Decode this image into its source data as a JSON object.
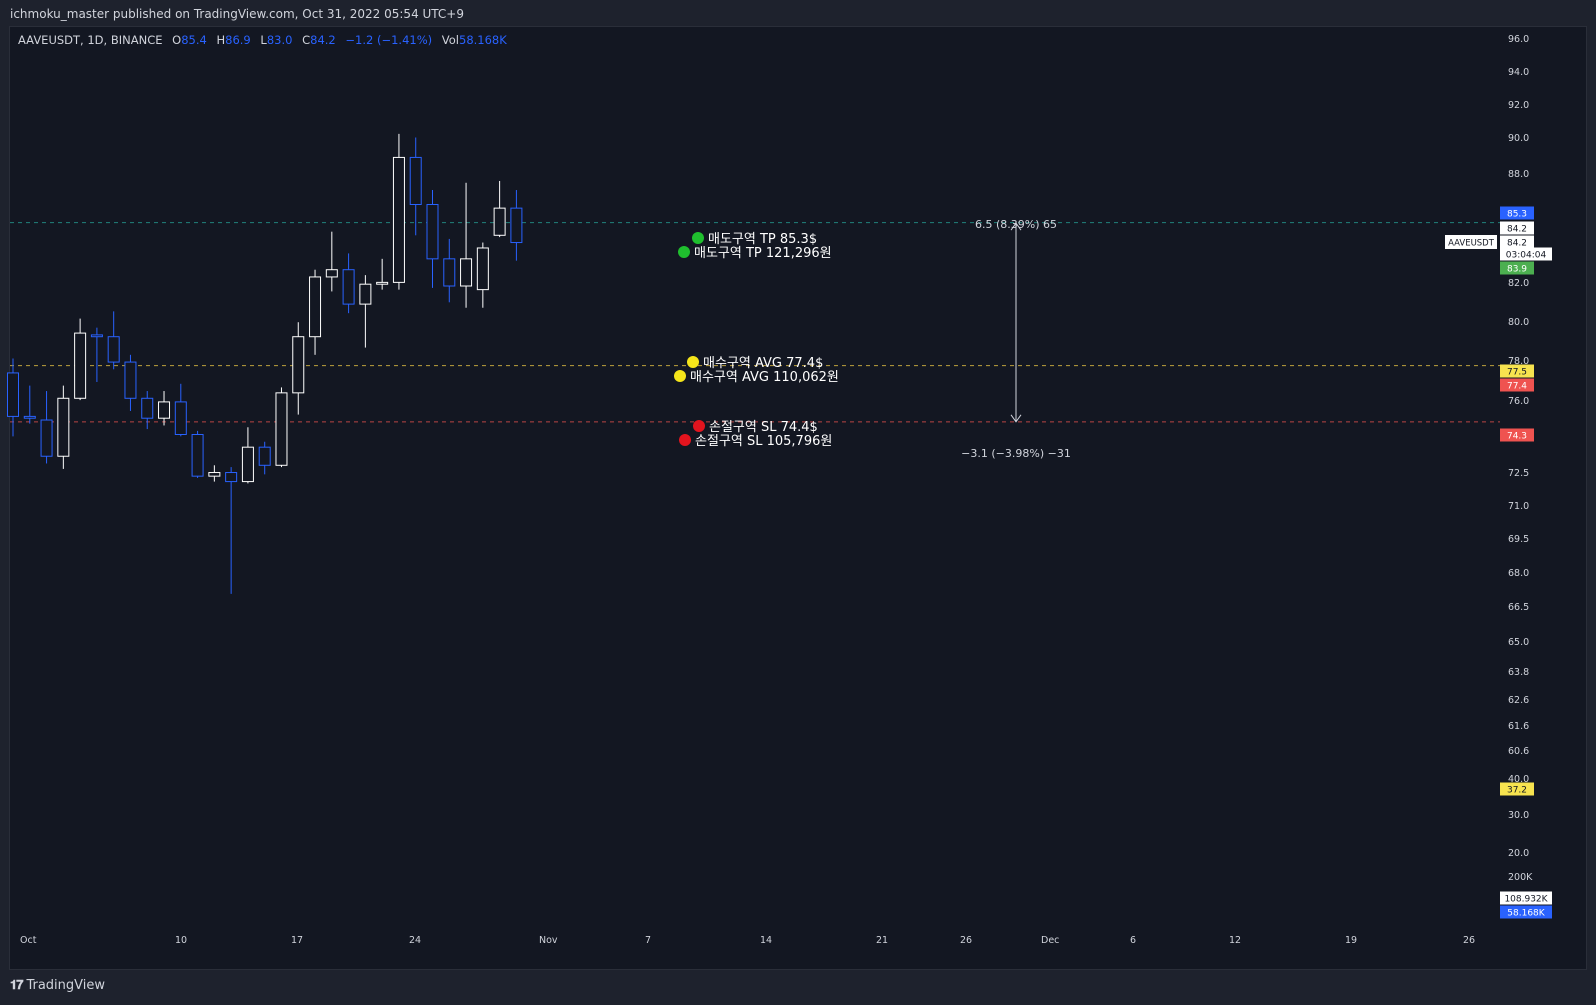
{
  "header": {
    "published_text": "ichmoku_master published on TradingView.com, Oct 31, 2022 05:54 UTC+9"
  },
  "legend": {
    "symbol": "AAVEUSDT, 1D, BINANCE",
    "open_label": "O",
    "open_value": "85.4",
    "high_label": "H",
    "high_value": "86.9",
    "low_label": "L",
    "low_value": "83.0",
    "close_label": "C",
    "close_value": "84.2",
    "change_value": "−1.2 (−1.41%)",
    "vol_label": "Vol",
    "vol_value": "58.168K"
  },
  "footer": {
    "brand_label": "TradingView"
  },
  "colors": {
    "background": "#131722",
    "up_candle": "#ffffff",
    "down_candle": "#2962ff",
    "tp_line": "#26a69a",
    "avg_line": "#f7d046",
    "sl_line": "#ef5350",
    "price_tag_blue": "#2962ff",
    "price_tag_green": "#4caf50",
    "price_tag_yellow": "#f7e34f",
    "price_tag_red": "#ef5350"
  },
  "chart_data": {
    "type": "candlestick",
    "symbol": "AAVEUSDT",
    "interval": "1D",
    "exchange": "BINANCE",
    "x_tick_labels": [
      "Oct",
      "10",
      "17",
      "24",
      "Nov",
      "7",
      "14",
      "21",
      "26",
      "Dec",
      "6",
      "12",
      "19",
      "26"
    ],
    "y_tick_labels": [
      "96.0",
      "94.0",
      "92.0",
      "90.0",
      "88.0",
      "82.0",
      "80.0",
      "78.0",
      "76.0",
      "72.5",
      "71.0",
      "69.5",
      "68.0",
      "66.5",
      "65.0",
      "63.8",
      "62.6",
      "61.6",
      "60.6",
      "40.0",
      "30.0",
      "20.0",
      "200K"
    ],
    "candles": [
      {
        "date": "2022-09-30",
        "open": 77.0,
        "high": 77.8,
        "low": 73.5,
        "close": 74.6
      },
      {
        "date": "2022-10-01",
        "open": 74.6,
        "high": 76.3,
        "low": 74.2,
        "close": 74.5
      },
      {
        "date": "2022-10-02",
        "open": 74.4,
        "high": 76.0,
        "low": 72.0,
        "close": 72.4
      },
      {
        "date": "2022-10-03",
        "open": 72.4,
        "high": 76.3,
        "low": 71.7,
        "close": 75.6
      },
      {
        "date": "2022-10-04",
        "open": 75.6,
        "high": 80.0,
        "low": 75.5,
        "close": 79.2
      },
      {
        "date": "2022-10-05",
        "open": 79.1,
        "high": 79.5,
        "low": 76.5,
        "close": 79.0
      },
      {
        "date": "2022-10-06",
        "open": 79.0,
        "high": 80.4,
        "low": 77.2,
        "close": 77.6
      },
      {
        "date": "2022-10-07",
        "open": 77.6,
        "high": 78.0,
        "low": 74.9,
        "close": 75.6
      },
      {
        "date": "2022-10-08",
        "open": 75.6,
        "high": 76.0,
        "low": 73.9,
        "close": 74.5
      },
      {
        "date": "2022-10-09",
        "open": 74.5,
        "high": 76.0,
        "low": 74.1,
        "close": 75.4
      },
      {
        "date": "2022-10-10",
        "open": 75.4,
        "high": 76.4,
        "low": 73.5,
        "close": 73.6
      },
      {
        "date": "2022-10-11",
        "open": 73.6,
        "high": 73.8,
        "low": 71.2,
        "close": 71.3
      },
      {
        "date": "2022-10-12",
        "open": 71.3,
        "high": 71.9,
        "low": 71.0,
        "close": 71.5
      },
      {
        "date": "2022-10-13",
        "open": 71.5,
        "high": 71.8,
        "low": 64.8,
        "close": 71.0
      },
      {
        "date": "2022-10-14",
        "open": 71.0,
        "high": 74.0,
        "low": 70.9,
        "close": 72.9
      },
      {
        "date": "2022-10-15",
        "open": 72.9,
        "high": 73.2,
        "low": 71.4,
        "close": 71.9
      },
      {
        "date": "2022-10-16",
        "open": 71.9,
        "high": 76.2,
        "low": 71.8,
        "close": 75.9
      },
      {
        "date": "2022-10-17",
        "open": 75.9,
        "high": 79.8,
        "low": 74.7,
        "close": 79.0
      },
      {
        "date": "2022-10-18",
        "open": 79.0,
        "high": 82.7,
        "low": 78.0,
        "close": 82.3
      },
      {
        "date": "2022-10-19",
        "open": 82.3,
        "high": 84.8,
        "low": 81.5,
        "close": 82.7
      },
      {
        "date": "2022-10-20",
        "open": 82.7,
        "high": 83.6,
        "low": 80.3,
        "close": 80.8
      },
      {
        "date": "2022-10-21",
        "open": 80.8,
        "high": 82.4,
        "low": 78.4,
        "close": 81.9
      },
      {
        "date": "2022-10-22",
        "open": 81.9,
        "high": 83.3,
        "low": 81.6,
        "close": 82.0
      },
      {
        "date": "2022-10-23",
        "open": 82.0,
        "high": 90.2,
        "low": 81.6,
        "close": 88.9
      },
      {
        "date": "2022-10-24",
        "open": 88.9,
        "high": 90.0,
        "low": 84.6,
        "close": 86.3
      },
      {
        "date": "2022-10-25",
        "open": 86.3,
        "high": 87.1,
        "low": 81.7,
        "close": 83.3
      },
      {
        "date": "2022-10-26",
        "open": 83.3,
        "high": 84.4,
        "low": 80.9,
        "close": 81.8
      },
      {
        "date": "2022-10-27",
        "open": 81.8,
        "high": 87.5,
        "low": 80.6,
        "close": 83.3
      },
      {
        "date": "2022-10-28",
        "open": 81.6,
        "high": 84.2,
        "low": 80.6,
        "close": 83.9
      },
      {
        "date": "2022-10-29",
        "open": 84.6,
        "high": 87.6,
        "low": 84.5,
        "close": 86.1
      },
      {
        "date": "2022-10-30",
        "open": 86.1,
        "high": 87.1,
        "low": 83.2,
        "close": 84.2
      }
    ],
    "levels": [
      {
        "name": "TP",
        "price": 85.3
      },
      {
        "name": "AVG",
        "price": 77.4
      },
      {
        "name": "SL",
        "price": 74.3
      }
    ],
    "price_tags": [
      {
        "text": "85.3",
        "color": "#2962ff"
      },
      {
        "text": "84.2",
        "color": "#ffffff"
      },
      {
        "text": "84.2",
        "color": "#ffffff"
      },
      {
        "text": "03:04:04",
        "color": "#ffffff"
      },
      {
        "text": "83.9",
        "color": "#4caf50"
      },
      {
        "text": "77.5",
        "color": "#f7e34f"
      },
      {
        "text": "77.4",
        "color": "#ef5350"
      },
      {
        "text": "74.3",
        "color": "#ef5350"
      },
      {
        "text": "37.2",
        "color": "#f7e34f"
      },
      {
        "text": "108.932K",
        "color": "#ffffff"
      },
      {
        "text": "58.168K",
        "color": "#2962ff"
      }
    ],
    "symbol_tag": "AAVEUSDT",
    "annotations": {
      "tp_usd": "매도구역 TP 85.3$",
      "tp_krw": "매도구역 TP 121,296원",
      "avg_usd": "매수구역 AVG 77.4$",
      "avg_krw": "매수구역 AVG 110,062원",
      "sl_usd": "손절구역 SL 74.4$",
      "sl_krw": "손절구역 SL 105,796원",
      "measure_up": "6.5 (8.39%) 65",
      "measure_down": "−3.1 (−3.98%) −31"
    }
  }
}
